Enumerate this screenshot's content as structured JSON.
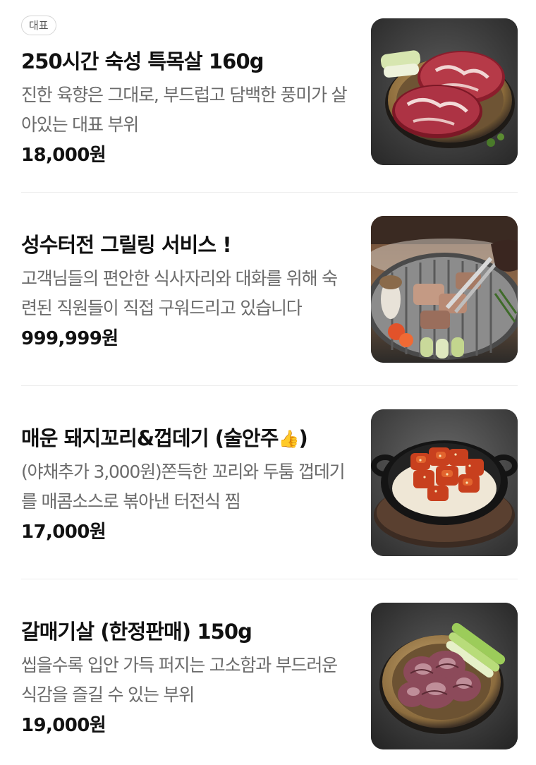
{
  "items": [
    {
      "badge": "대표",
      "name": "250시간 숙성 특목살 160g",
      "description": "진한 육향은 그대로, 부드럽고 담백한 풍미가 살아있는 대표 부위",
      "price": "18,000원",
      "image": "grilled-pork-neck-photo"
    },
    {
      "name": "성수터전 그릴링 서비스 !",
      "description": "고객님들의 편안한 식사자리와 대화를 위해 숙련된 직원들이 직접 구워드리고 있습니다",
      "price": "999,999원",
      "image": "grilling-service-photo"
    },
    {
      "name_prefix": "매운 돼지꼬리&껍데기 (술안주",
      "name_emoji": "👍",
      "name_suffix": ")",
      "description": "(야채추가 3,000원)쫀득한 꼬리와 두툼 껍데기를 매콤소스로 볶아낸 터전식 찜",
      "price": "17,000원",
      "image": "spicy-pork-tail-skillet-photo"
    },
    {
      "name": "갈매기살 (한정판매) 150g",
      "description": "씹을수록 입안 가득 퍼지는 고소함과 부드러운 식감을 즐길 수 있는 부위",
      "price": "19,000원",
      "image": "skirt-meat-plate-photo"
    }
  ]
}
